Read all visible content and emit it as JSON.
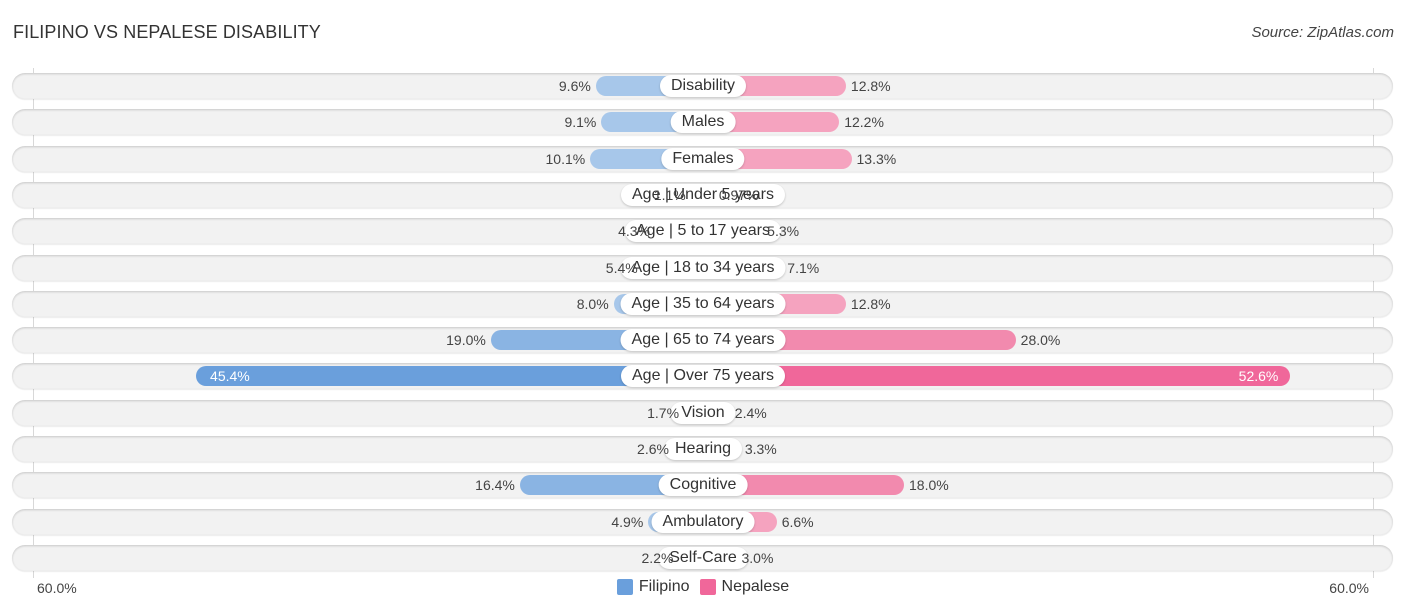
{
  "header": {
    "title": "FILIPINO VS NEPALESE DISABILITY",
    "source": "Source: ZipAtlas.com"
  },
  "chart_data": {
    "type": "bar",
    "orientation": "horizontal-diverging",
    "title": "FILIPINO VS NEPALESE DISABILITY",
    "categories": [
      "Disability",
      "Males",
      "Females",
      "Age | Under 5 years",
      "Age | 5 to 17 years",
      "Age | 18 to 34 years",
      "Age | 35 to 64 years",
      "Age | 65 to 74 years",
      "Age | Over 75 years",
      "Vision",
      "Hearing",
      "Cognitive",
      "Ambulatory",
      "Self-Care"
    ],
    "series": [
      {
        "name": "Filipino",
        "color": "#6a9fdc",
        "values": [
          9.6,
          9.1,
          10.1,
          1.1,
          4.3,
          5.4,
          8.0,
          19.0,
          45.4,
          1.7,
          2.6,
          16.4,
          4.9,
          2.2
        ],
        "labels": [
          "9.6%",
          "9.1%",
          "10.1%",
          "1.1%",
          "4.3%",
          "5.4%",
          "8.0%",
          "19.0%",
          "45.4%",
          "1.7%",
          "2.6%",
          "16.4%",
          "4.9%",
          "2.2%"
        ]
      },
      {
        "name": "Nepalese",
        "color": "#f0679a",
        "values": [
          12.8,
          12.2,
          13.3,
          0.97,
          5.3,
          7.1,
          12.8,
          28.0,
          52.6,
          2.4,
          3.3,
          18.0,
          6.6,
          3.0
        ],
        "labels": [
          "12.8%",
          "12.2%",
          "13.3%",
          "0.97%",
          "5.3%",
          "7.1%",
          "12.8%",
          "28.0%",
          "52.6%",
          "2.4%",
          "3.3%",
          "18.0%",
          "6.6%",
          "3.0%"
        ]
      }
    ],
    "xlim": [
      -60,
      60
    ],
    "axis_labels": {
      "left": "60.0%",
      "right": "60.0%"
    },
    "legend": {
      "position": "bottom-center",
      "entries": [
        "Filipino",
        "Nepalese"
      ]
    },
    "grid": false
  }
}
